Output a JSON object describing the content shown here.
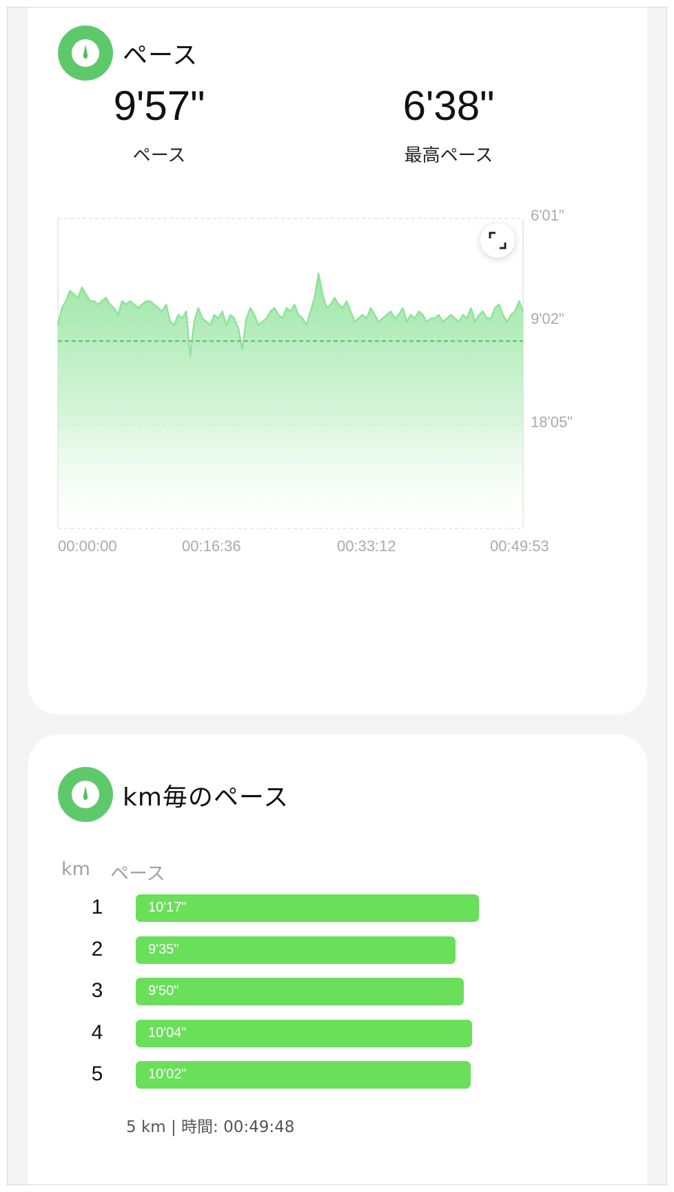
{
  "pace_section": {
    "title": "ペース",
    "avg_pace_value": "9'57\"",
    "avg_pace_label": "ペース",
    "max_pace_value": "6'38\"",
    "max_pace_label": "最高ペース"
  },
  "chart_data": {
    "type": "area",
    "y_ticks": [
      "6'01\"",
      "9'02\"",
      "18'05\""
    ],
    "x_ticks": [
      "00:00:00",
      "00:16:36",
      "00:33:12",
      "00:49:53"
    ],
    "average_line": "9'57\"",
    "fill_color": "#7fe08a",
    "line_color": "#8fe39a",
    "series": [
      {
        "values": [
          9.3,
          9.8,
          10.0,
          10.3,
          10.2,
          10.1,
          10.4,
          10.2,
          10.0,
          10.0,
          9.9,
          10.0,
          10.1,
          9.9,
          9.8,
          9.6,
          10.0,
          9.9,
          10.0,
          9.9,
          9.8,
          9.9,
          10.0,
          10.0,
          9.9,
          9.8,
          9.7,
          9.9,
          9.4,
          9.3,
          9.6,
          9.5,
          9.7,
          8.4,
          9.4,
          9.8,
          9.5,
          9.4,
          9.3,
          9.6,
          9.5,
          9.7,
          9.3,
          9.6,
          9.5,
          9.2,
          8.6,
          9.5,
          9.8,
          9.6,
          9.3,
          9.4,
          9.5,
          9.7,
          9.8,
          9.6,
          9.5,
          9.8,
          9.7,
          9.9,
          9.6,
          9.5,
          9.3,
          9.7,
          10.1,
          10.8,
          10.2,
          9.8,
          9.9,
          10.1,
          9.9,
          9.8,
          10.0,
          9.7,
          9.4,
          9.5,
          9.6,
          9.5,
          9.8,
          9.6,
          9.4,
          9.5,
          9.6,
          9.7,
          9.5,
          9.6,
          9.8,
          9.4,
          9.6,
          9.5,
          9.7,
          9.6,
          9.4,
          9.5,
          9.5,
          9.6,
          9.4,
          9.5,
          9.6,
          9.5,
          9.4,
          9.6,
          9.5,
          9.8,
          9.4,
          9.6,
          9.7,
          9.5,
          9.5,
          9.8,
          9.9,
          9.6,
          9.4,
          9.6,
          9.7,
          10.0,
          9.7
        ]
      }
    ]
  },
  "expand_icon": "expand-icon",
  "km_section": {
    "title": "km毎のペース",
    "col_km": "km",
    "col_pace": "ペース",
    "rows": [
      {
        "km": "1",
        "pace": "10'17\"",
        "seconds": 617
      },
      {
        "km": "2",
        "pace": "9'35\"",
        "seconds": 575
      },
      {
        "km": "3",
        "pace": "9'50\"",
        "seconds": 590
      },
      {
        "km": "4",
        "pace": "10'04\"",
        "seconds": 604
      },
      {
        "km": "5",
        "pace": "10'02\"",
        "seconds": 602
      }
    ],
    "summary": "5 km | 時間: 00:49:48"
  },
  "colors": {
    "accent": "#5dc96b",
    "bar": "#6adf5a"
  }
}
